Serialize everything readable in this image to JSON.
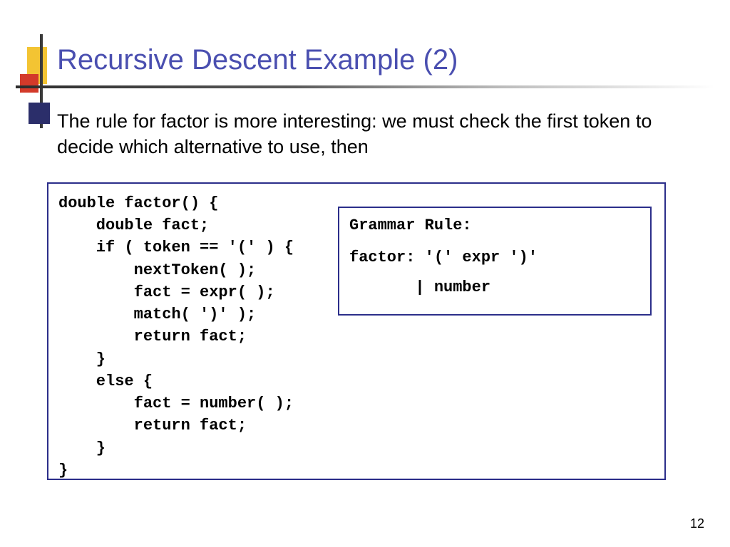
{
  "title": "Recursive Descent Example (2)",
  "body": "The rule for factor is more interesting: we must check the first token to decide which alternative to use, then",
  "code": "double factor() {\n    double fact;\n    if ( token == '(' ) {\n        nextToken( );\n        fact = expr( );\n        match( ')' );\n        return fact;\n    }\n    else {\n        fact = number( );\n        return fact;\n    }\n}",
  "grammar": {
    "heading": "Grammar Rule:",
    "line1": "factor: '(' expr ')'",
    "line2": "       | number"
  },
  "page_number": "12"
}
